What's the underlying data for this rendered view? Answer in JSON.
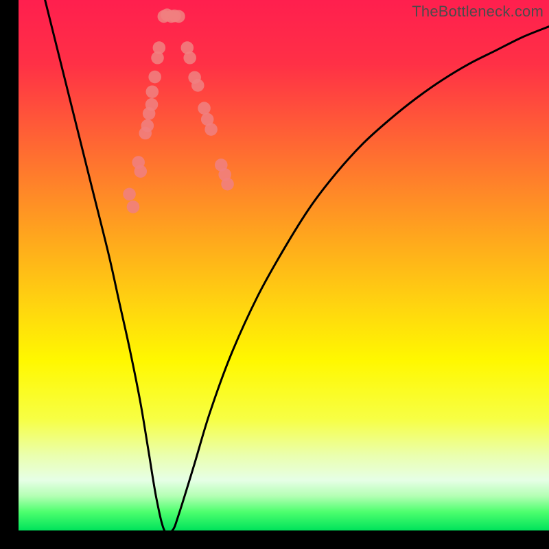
{
  "watermark": "TheBottleneck.com",
  "chart_data": {
    "type": "line",
    "title": "",
    "xlabel": "",
    "ylabel": "",
    "xlim": [
      0,
      100
    ],
    "ylim": [
      0,
      100
    ],
    "gradient_stops": [
      {
        "offset": 0.0,
        "color": "#ff1f4e"
      },
      {
        "offset": 0.12,
        "color": "#ff3046"
      },
      {
        "offset": 0.28,
        "color": "#ff6a32"
      },
      {
        "offset": 0.44,
        "color": "#ffa41e"
      },
      {
        "offset": 0.58,
        "color": "#ffd60f"
      },
      {
        "offset": 0.68,
        "color": "#fff800"
      },
      {
        "offset": 0.79,
        "color": "#f7ff44"
      },
      {
        "offset": 0.86,
        "color": "#eaffb0"
      },
      {
        "offset": 0.905,
        "color": "#e6ffe6"
      },
      {
        "offset": 0.935,
        "color": "#b4ffb4"
      },
      {
        "offset": 0.965,
        "color": "#4dff6e"
      },
      {
        "offset": 1.0,
        "color": "#00e25b"
      }
    ],
    "series": [
      {
        "name": "curve",
        "x": [
          5,
          8,
          11,
          14,
          17,
          19,
          21,
          23,
          24.5,
          26,
          27.5,
          29,
          30.2,
          33,
          36,
          40,
          45,
          50,
          55,
          60,
          65,
          70,
          75,
          80,
          85,
          90,
          95,
          100
        ],
        "y": [
          100,
          88,
          76,
          64,
          52,
          43,
          34,
          24,
          15,
          6,
          0,
          0,
          3,
          12,
          22,
          33,
          44,
          53,
          61,
          67.5,
          73,
          77.5,
          81.5,
          85,
          88,
          90.5,
          93,
          95
        ]
      }
    ],
    "markers": [
      {
        "x": 20.9,
        "y": 63.4
      },
      {
        "x": 21.6,
        "y": 61.0
      },
      {
        "x": 22.6,
        "y": 69.4
      },
      {
        "x": 23.0,
        "y": 67.7
      },
      {
        "x": 23.9,
        "y": 74.9
      },
      {
        "x": 24.3,
        "y": 76.3
      },
      {
        "x": 24.6,
        "y": 78.6
      },
      {
        "x": 25.1,
        "y": 80.3
      },
      {
        "x": 25.2,
        "y": 82.7
      },
      {
        "x": 25.7,
        "y": 85.5
      },
      {
        "x": 26.2,
        "y": 89.1
      },
      {
        "x": 26.5,
        "y": 91.0
      },
      {
        "x": 27.4,
        "y": 96.9
      },
      {
        "x": 28.0,
        "y": 97.2
      },
      {
        "x": 28.8,
        "y": 96.9
      },
      {
        "x": 29.4,
        "y": 97.0
      },
      {
        "x": 30.2,
        "y": 96.9
      },
      {
        "x": 31.8,
        "y": 91.0
      },
      {
        "x": 32.3,
        "y": 89.1
      },
      {
        "x": 33.8,
        "y": 83.9
      },
      {
        "x": 33.2,
        "y": 85.4
      },
      {
        "x": 35.0,
        "y": 79.6
      },
      {
        "x": 35.6,
        "y": 77.5
      },
      {
        "x": 36.3,
        "y": 75.6
      },
      {
        "x": 38.2,
        "y": 68.9
      },
      {
        "x": 38.9,
        "y": 67.1
      },
      {
        "x": 39.4,
        "y": 65.3
      }
    ],
    "marker_color": "#f08080",
    "marker_radius_pct": 1.2
  }
}
